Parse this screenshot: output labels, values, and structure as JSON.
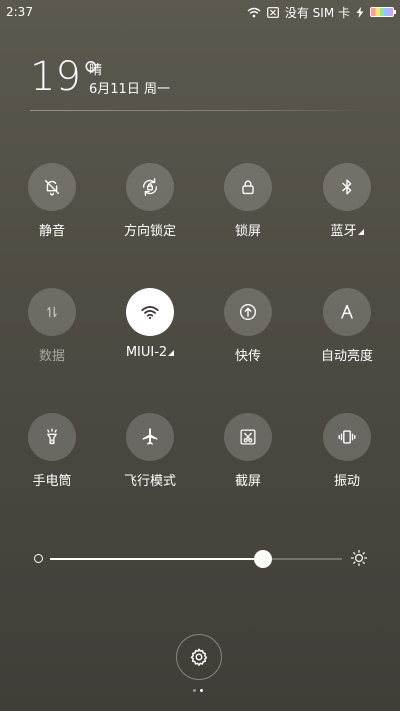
{
  "status_bar": {
    "time": "2:37",
    "sim_text": "没有 SIM 卡",
    "icons": [
      "wifi-icon",
      "sim-off-icon",
      "charging-icon",
      "battery-icon"
    ]
  },
  "weather": {
    "temperature": "19°",
    "condition": "晴",
    "date": "6月11日 周一"
  },
  "toggles": [
    {
      "label": "静音",
      "icon": "bell-off-icon",
      "active": false,
      "dim": false
    },
    {
      "label": "方向锁定",
      "icon": "rotation-lock-icon",
      "active": false,
      "dim": false
    },
    {
      "label": "锁屏",
      "icon": "lock-icon",
      "active": false,
      "dim": false
    },
    {
      "label": "蓝牙",
      "icon": "bluetooth-icon",
      "active": false,
      "dim": false,
      "has_menu": true
    },
    {
      "label": "数据",
      "icon": "mobile-data-icon",
      "active": false,
      "dim": true
    },
    {
      "label": "MIUI-2",
      "icon": "wifi-icon",
      "active": true,
      "dim": false,
      "has_menu": true
    },
    {
      "label": "快传",
      "icon": "quick-transfer-icon",
      "active": false,
      "dim": false
    },
    {
      "label": "自动亮度",
      "icon": "auto-brightness-icon",
      "active": false,
      "dim": false
    },
    {
      "label": "手电筒",
      "icon": "flashlight-icon",
      "active": false,
      "dim": false
    },
    {
      "label": "飞行模式",
      "icon": "airplane-icon",
      "active": false,
      "dim": false
    },
    {
      "label": "截屏",
      "icon": "screenshot-icon",
      "active": false,
      "dim": false
    },
    {
      "label": "振动",
      "icon": "vibrate-icon",
      "active": false,
      "dim": false
    }
  ],
  "brightness": {
    "level": 0.73
  },
  "pager": {
    "pages": 2,
    "current": 2
  },
  "colors": {
    "active_tile": "#ffffff",
    "inactive_tile": "rgba(255,255,255,0.18)"
  }
}
